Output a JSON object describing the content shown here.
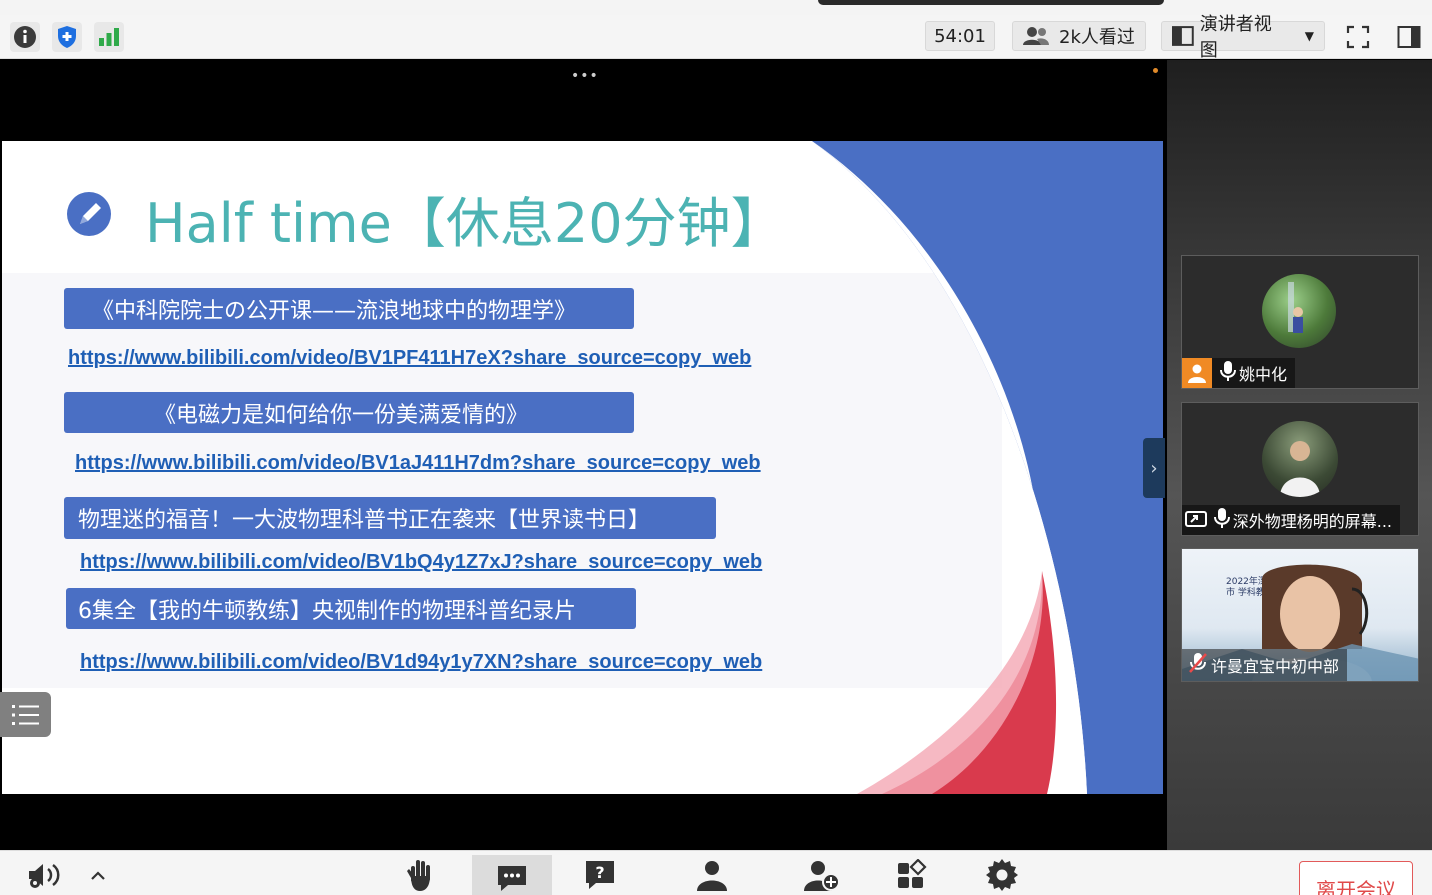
{
  "toolbar": {
    "timer": "54:01",
    "viewers": "2k人看过",
    "view_mode": "演讲者视图"
  },
  "slide": {
    "title": "Half time【休息20分钟】",
    "items": [
      {
        "label": "《中科院院士の公开课——流浪地球中的物理学》",
        "url": "https://www.bilibili.com/video/BV1PF411H7eX?share_source=copy_web"
      },
      {
        "label": "《电磁力是如何给你一份美满爱情的》",
        "url": "https://www.bilibili.com/video/BV1aJ411H7dm?share_source=copy_web"
      },
      {
        "label": "物理迷的福音！一大波物理科普书正在袭来【世界读书日】",
        "url": "https://www.bilibili.com/video/BV1bQ4y1Z7xJ?share_source=copy_web"
      },
      {
        "label": "6集全【我的牛顿教练】央视制作的物理科普纪录片",
        "url": "https://www.bilibili.com/video/BV1d94y1y7XN?share_source=copy_web"
      }
    ]
  },
  "participants": [
    {
      "name": "姚中化"
    },
    {
      "name": "深外物理杨明的屏幕..."
    },
    {
      "name": "许曼宜宝中初中部",
      "bg_text": "2022年深圳市 学科教师"
    }
  ],
  "bottom": {
    "leave_label": "离开会议"
  },
  "colors": {
    "accent_blue": "#4a6fc4",
    "title_teal": "#4cb3b3",
    "leave_red": "#e04a4a"
  }
}
